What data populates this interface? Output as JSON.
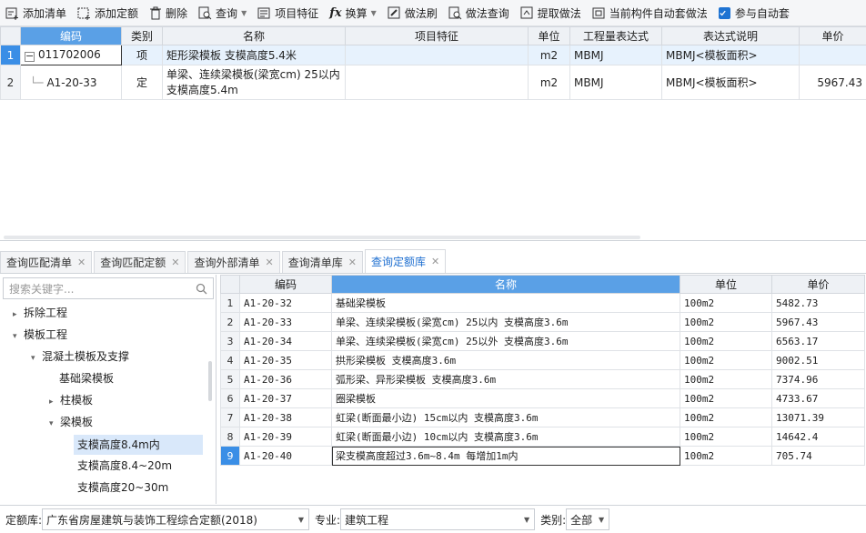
{
  "toolbar": {
    "add_list": "添加清单",
    "add_quota": "添加定额",
    "delete": "删除",
    "query": "查询",
    "item_feature": "项目特征",
    "convert": "换算",
    "method_brush": "做法刷",
    "method_query": "做法查询",
    "extract_method": "提取做法",
    "auto_method": "当前构件自动套做法",
    "auto_join": "参与自动套"
  },
  "top_table": {
    "headers": [
      "编码",
      "类别",
      "名称",
      "项目特征",
      "单位",
      "工程量表达式",
      "表达式说明",
      "单价"
    ],
    "rows": [
      {
        "num": "1",
        "code": "011702006",
        "type": "项",
        "name": "矩形梁模板 支模高度5.4米",
        "name2": "",
        "feature": "",
        "unit": "m2",
        "expr": "MBMJ",
        "expr_desc": "MBMJ<模板面积>",
        "price": ""
      },
      {
        "num": "2",
        "code": "A1-20-33",
        "type": "定",
        "name": "单梁、连续梁模板(梁宽cm) 25以内",
        "name2": "支模高度5.4m",
        "feature": "",
        "unit": "m2",
        "expr": "MBMJ",
        "expr_desc": "MBMJ<模板面积>",
        "price": "5967.43"
      }
    ]
  },
  "tabs": [
    "查询匹配清单",
    "查询匹配定额",
    "查询外部清单",
    "查询清单库",
    "查询定额库"
  ],
  "search": {
    "placeholder": "搜索关键字..."
  },
  "tree": {
    "demolition": "拆除工程",
    "formwork": "模板工程",
    "concrete_support": "混凝土模板及支撑",
    "base_beam": "基础梁模板",
    "column": "柱模板",
    "beam": "梁模板",
    "h84": "支模高度8.4m内",
    "h8420": "支模高度8.4~20m",
    "h2030": "支模高度20~30m"
  },
  "bottom_table": {
    "headers": [
      "编码",
      "名称",
      "单位",
      "单价"
    ],
    "rows": [
      {
        "num": "1",
        "code": "A1-20-32",
        "name": "基础梁模板",
        "unit": "100m2",
        "price": "5482.73"
      },
      {
        "num": "2",
        "code": "A1-20-33",
        "name": "单梁、连续梁模板(梁宽cm) 25以内 支模高度3.6m",
        "unit": "100m2",
        "price": "5967.43"
      },
      {
        "num": "3",
        "code": "A1-20-34",
        "name": "单梁、连续梁模板(梁宽cm) 25以外 支模高度3.6m",
        "unit": "100m2",
        "price": "6563.17"
      },
      {
        "num": "4",
        "code": "A1-20-35",
        "name": "拱形梁模板 支模高度3.6m",
        "unit": "100m2",
        "price": "9002.51"
      },
      {
        "num": "5",
        "code": "A1-20-36",
        "name": "弧形梁、异形梁模板 支模高度3.6m",
        "unit": "100m2",
        "price": "7374.96"
      },
      {
        "num": "6",
        "code": "A1-20-37",
        "name": "圈梁模板",
        "unit": "100m2",
        "price": "4733.67"
      },
      {
        "num": "7",
        "code": "A1-20-38",
        "name": "虹梁(断面最小边) 15cm以内 支模高度3.6m",
        "unit": "100m2",
        "price": "13071.39"
      },
      {
        "num": "8",
        "code": "A1-20-39",
        "name": "虹梁(断面最小边) 10cm以内 支模高度3.6m",
        "unit": "100m2",
        "price": "14642.4"
      },
      {
        "num": "9",
        "code": "A1-20-40",
        "name": "梁支模高度超过3.6m~8.4m 每增加1m内",
        "unit": "100m2",
        "price": "705.74"
      }
    ]
  },
  "status": {
    "quota_lib_label": "定额库:",
    "quota_lib_value": "广东省房屋建筑与装饰工程综合定额(2018)",
    "major_label": "专业:",
    "major_value": "建筑工程",
    "category_label": "类别:",
    "category_value": "全部"
  }
}
